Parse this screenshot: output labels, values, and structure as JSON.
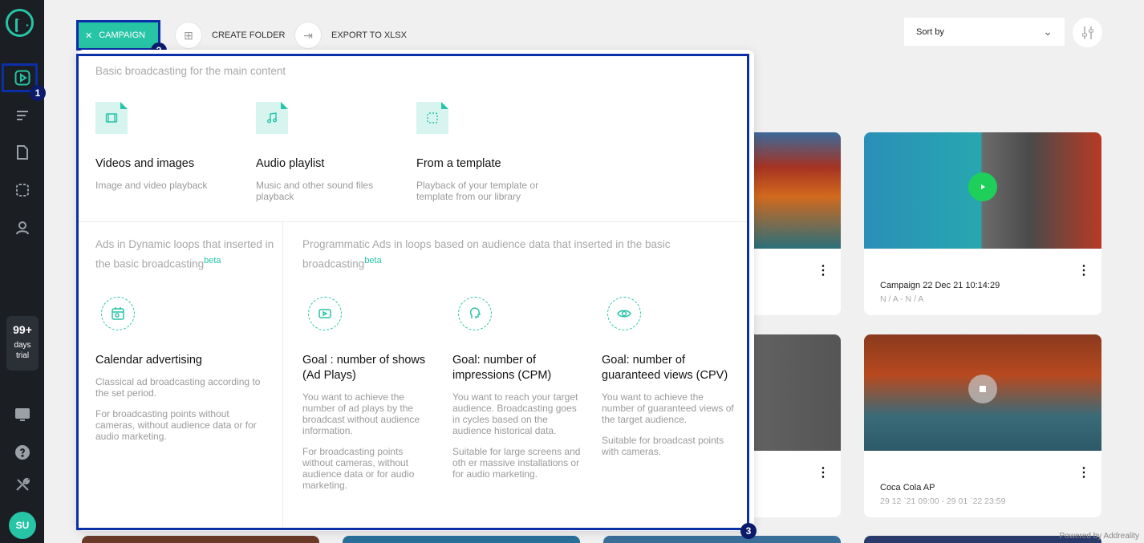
{
  "sidebar": {
    "icons": [
      "logo-icon",
      "campaign-play-icon",
      "playlist-icon",
      "document-icon",
      "template-icon",
      "user-icon",
      "monitor-icon",
      "help-icon",
      "tools-icon"
    ],
    "trial": {
      "number": "99+",
      "line1": "days",
      "line2": "trial"
    },
    "avatar": "SU"
  },
  "annotations": {
    "n1": "1",
    "n2": "2",
    "n3": "3"
  },
  "toolbar": {
    "campaign_label": "CAMPAIGN",
    "create_folder_label": "CREATE FOLDER",
    "export_label": "EXPORT TO XLSX",
    "sort_label": "Sort by"
  },
  "cards": [
    {
      "title": "Campaign 22 Dec 21 10:14:29",
      "sub": "N / A - N / A"
    },
    {
      "title": "Coca Cola AP",
      "sub": "29 12 `21 09:00 - 29 01 `22 23:59"
    }
  ],
  "footer": {
    "powered": "Powered by Addreality"
  },
  "panel": {
    "basic_title": "Basic broadcasting for the main content",
    "basic_options": [
      {
        "name": "Videos and images",
        "desc": "Image and video playback"
      },
      {
        "name": "Audio playlist",
        "desc": "Music and other sound files playback"
      },
      {
        "name": "From a template",
        "desc": "Playback of your template or template from our library"
      }
    ],
    "dynamic_title": "Ads in Dynamic loops that inserted in the basic broadcasting",
    "dynamic_beta": "beta",
    "programmatic_title": "Programmatic Ads in loops based on audience data that inserted in the basic broadcasting",
    "programmatic_beta": "beta",
    "calendar": {
      "name": "Calendar advertising",
      "desc1": "Classical ad broadcasting according to the set period.",
      "desc2": "For broadcasting points without cameras, without audience data or for audio marketing."
    },
    "goals": [
      {
        "name": "Goal : number of shows (Ad Plays)",
        "desc1": "You want to achieve the number of ad plays by the broadcast without audience information.",
        "desc2": "For broadcasting points without cameras, without audience data or for audio marketing."
      },
      {
        "name": "Goal: number of impressions (CPM)",
        "desc1": "You want to reach your target audience. Broadcasting goes in cycles based on the audience historical data.",
        "desc2": "Suitable for large screens and oth er massive installations or for audio marketing."
      },
      {
        "name": "Goal: number of guaranteed views (CPV)",
        "desc1": "You want to achieve the number of guaranteed views of the target audience.",
        "desc2": "Suitable for broadcast points with cameras."
      }
    ]
  }
}
